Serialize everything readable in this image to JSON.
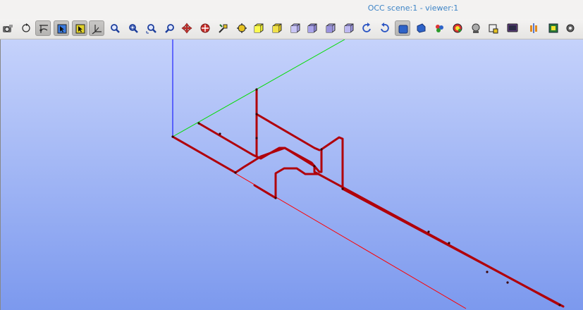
{
  "window": {
    "title": "OCC scene:1 - viewer:1"
  },
  "toolbar": {
    "buttons": [
      {
        "icon": "camera-icon",
        "active": false
      },
      {
        "icon": "rotate-icon",
        "active": false
      },
      {
        "icon": "select-vertex-icon",
        "active": true
      },
      {
        "icon": "select-edge-icon",
        "active": true
      },
      {
        "icon": "select-face-icon",
        "active": true
      },
      {
        "icon": "trihedron-icon",
        "active": true
      },
      {
        "icon": "zoom-icon",
        "active": false
      },
      {
        "icon": "zoom-window-icon",
        "active": false
      },
      {
        "icon": "zoom-fit-icon",
        "active": false
      },
      {
        "icon": "zoom-selection-icon",
        "active": false
      },
      {
        "icon": "pan-icon",
        "active": false
      },
      {
        "icon": "global-pan-icon",
        "active": false
      },
      {
        "icon": "rotation-center-icon",
        "active": false
      },
      {
        "icon": "fit-all-icon",
        "active": false
      },
      {
        "icon": "view-front-icon",
        "active": false
      },
      {
        "icon": "view-back-icon",
        "active": false
      },
      {
        "icon": "view-top-icon",
        "active": false
      },
      {
        "icon": "view-bottom-icon",
        "active": false
      },
      {
        "icon": "view-left-icon",
        "active": false
      },
      {
        "icon": "view-right-icon",
        "active": false
      },
      {
        "icon": "rotate-counterclockwise-icon",
        "active": false
      },
      {
        "icon": "rotate-clockwise-icon",
        "active": false
      },
      {
        "icon": "shaded-mode-icon",
        "active": true
      },
      {
        "icon": "wireframe-mode-icon",
        "active": false
      },
      {
        "icon": "color-icon",
        "active": false
      },
      {
        "icon": "material-icon",
        "active": false
      },
      {
        "icon": "clipping-icon",
        "active": false
      },
      {
        "icon": "graduated-axes-icon",
        "active": false
      },
      {
        "icon": "screen-icon",
        "active": false
      },
      {
        "icon": "mirror-icon",
        "active": false
      },
      {
        "icon": "image-export-icon",
        "active": false
      },
      {
        "icon": "settings-icon",
        "active": false
      }
    ]
  },
  "scene": {
    "background_top": "#c5d2fb",
    "background_bottom": "#7c99ee",
    "pipe_color": "#b0000a",
    "axis_x_color": "#ff0000",
    "axis_y_color": "#00dd00",
    "axis_z_color": "#0000ff"
  }
}
